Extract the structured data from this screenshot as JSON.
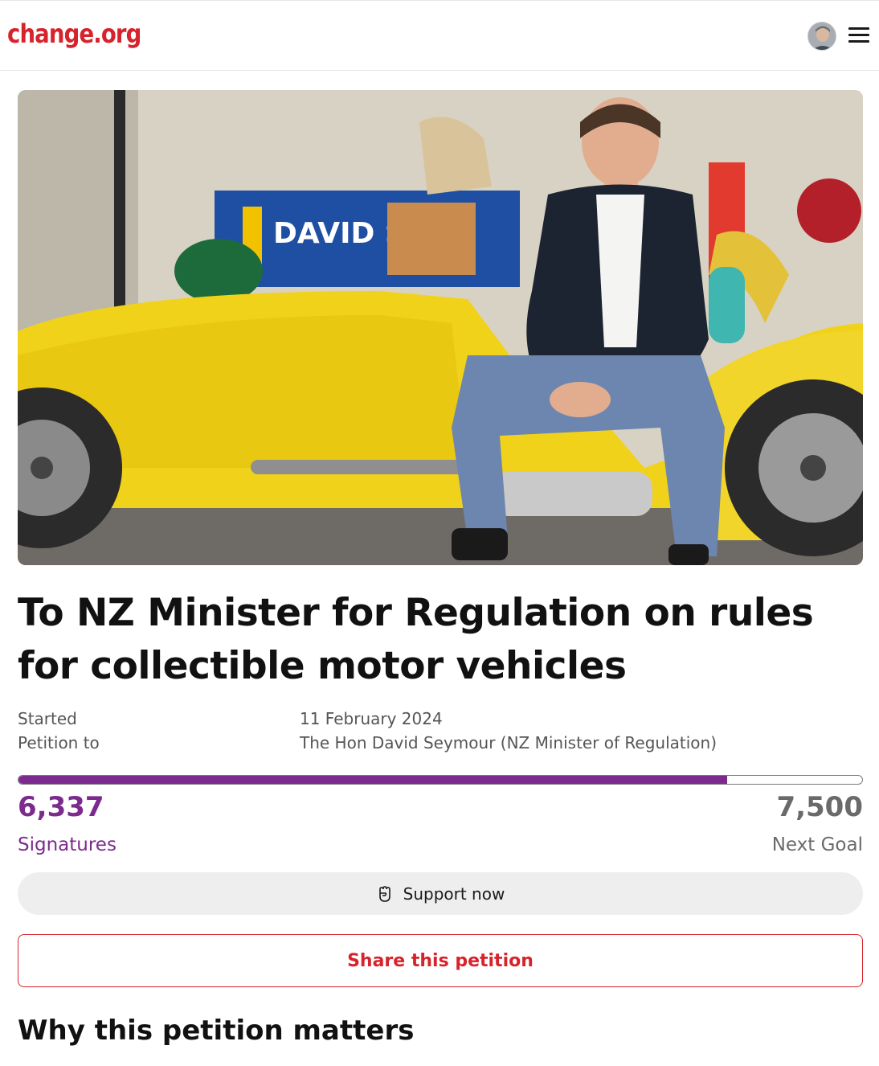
{
  "header": {
    "logo": "change.org",
    "avatar_icon": "user-avatar",
    "menu_icon": "hamburger-menu-icon"
  },
  "hero": {
    "photo_sign_text": "DAVID SEY"
  },
  "petition": {
    "title": "To NZ Minister for Regulation on rules for collectible motor vehicles",
    "started_label": "Started",
    "started_value": "11 February 2024",
    "petition_to_label": "Petition to",
    "petition_to_value": "The Hon David Seymour (NZ Minister of Regulation)"
  },
  "progress": {
    "signatures_count": "6,337",
    "signatures_label": "Signatures",
    "goal_count": "7,500",
    "goal_label": "Next Goal",
    "fraction": 0.84,
    "bar_color": "#7d2a8f"
  },
  "actions": {
    "support_label": "Support now",
    "support_icon": "raised-fist-icon",
    "share_label": "Share this petition"
  },
  "section": {
    "why_heading": "Why this petition matters"
  },
  "colors": {
    "brand": "#d7232c",
    "accent": "#7d2a8f"
  }
}
